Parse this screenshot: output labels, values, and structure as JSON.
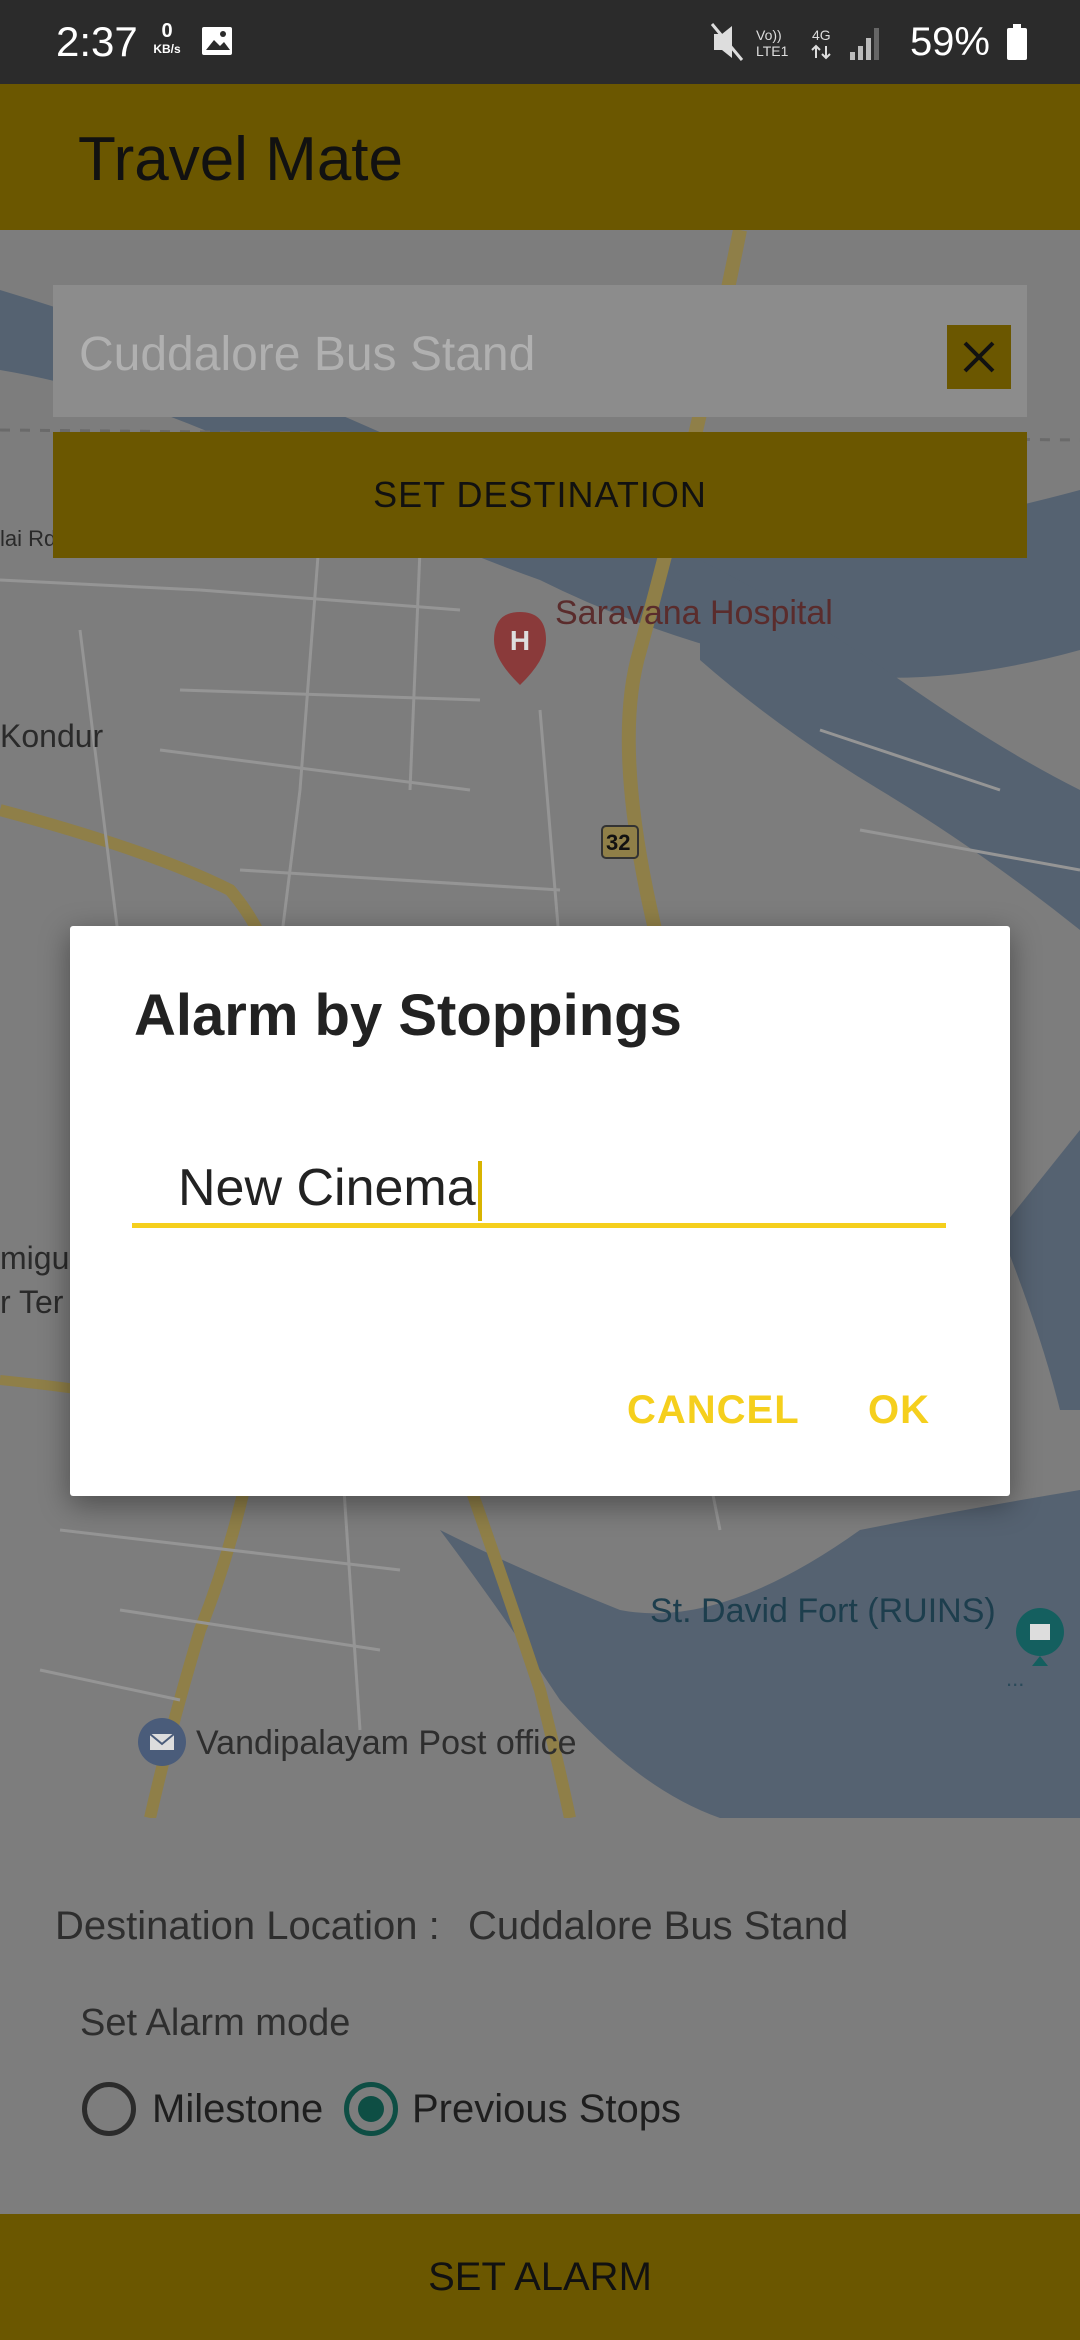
{
  "status_bar": {
    "time": "2:37",
    "data_rate_value": "0",
    "data_rate_unit": "KB/s",
    "battery": "59%",
    "icons": [
      "image-icon",
      "mute-icon",
      "volte-icon",
      "4g-icon",
      "signal-icon",
      "battery-icon"
    ]
  },
  "app_bar": {
    "title": "Travel Mate"
  },
  "search": {
    "value": "Cuddalore Bus Stand"
  },
  "set_destination_label": "SET DESTINATION",
  "map": {
    "labels": {
      "saravana": "Saravana Hospital",
      "kondur": "Kondur",
      "road32": "32",
      "david_fort": "St. David Fort (RUINS)",
      "vandipalayam": "Vandipalayam Post office",
      "rd": "lai Rd",
      "migu": "migu",
      "ter": "r Ter"
    }
  },
  "dialog": {
    "title": "Alarm by Stoppings",
    "input_value": "New Cinema",
    "cancel_label": "CANCEL",
    "ok_label": "OK"
  },
  "bottom": {
    "destination_label": "Destination Location :",
    "destination_value": "Cuddalore Bus Stand",
    "mode_label": "Set Alarm mode",
    "options": [
      "Milestone",
      "Previous Stops"
    ],
    "selected": "Previous Stops"
  },
  "set_alarm_label": "SET ALARM",
  "colors": {
    "accent": "#f5cf1d",
    "app_bar_dimmed": "#6b5700",
    "radio_checked": "#0e4e44"
  }
}
